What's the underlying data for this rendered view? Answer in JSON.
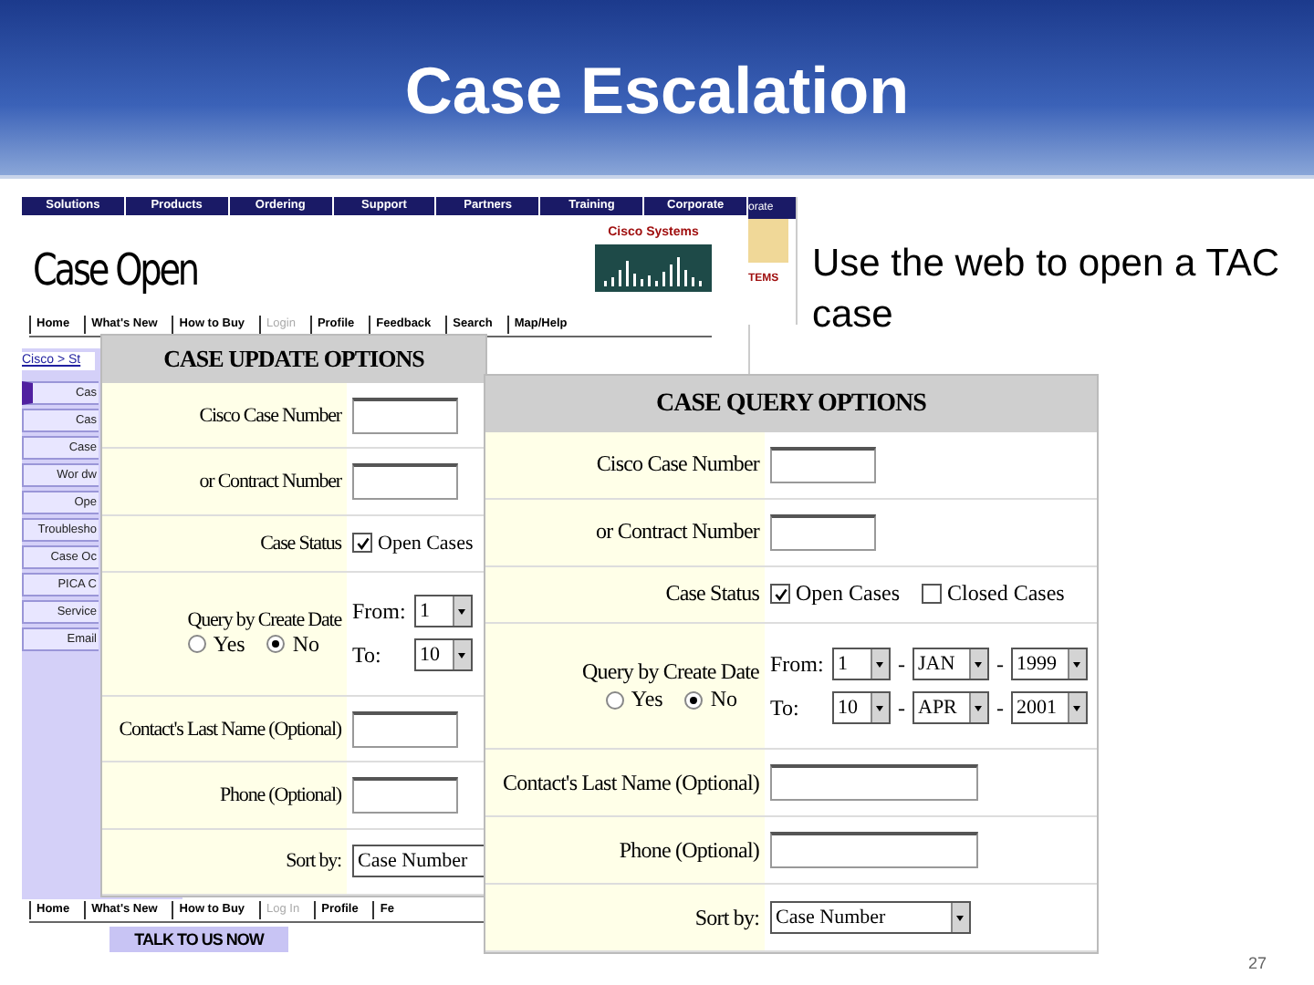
{
  "slide": {
    "title": "Case Escalation",
    "bullet": "Use the web to open a TAC case",
    "page_number": "27"
  },
  "case_open_page": {
    "top_nav": [
      "Solutions",
      "Products",
      "Ordering",
      "Support",
      "Partners",
      "Training",
      "Corporate"
    ],
    "heading": "Case Open",
    "logo_text": "Cisco Systems",
    "links": [
      {
        "label": "Home",
        "disabled": false
      },
      {
        "label": "What's New",
        "disabled": false
      },
      {
        "label": "How to Buy",
        "disabled": false
      },
      {
        "label": "Login",
        "disabled": true
      },
      {
        "label": "Profile",
        "disabled": false
      },
      {
        "label": "Feedback",
        "disabled": false
      },
      {
        "label": "Search",
        "disabled": false
      },
      {
        "label": "Map/Help",
        "disabled": false
      }
    ],
    "breadcrumb": "Cisco > St",
    "sidebar": [
      {
        "label": "Cas",
        "selected": true
      },
      {
        "label": "Cas",
        "selected": false
      },
      {
        "label": "Case",
        "selected": false
      },
      {
        "label": "Wor dw",
        "selected": false
      },
      {
        "label": "Ope",
        "selected": false
      },
      {
        "label": "Troublesho",
        "selected": false
      },
      {
        "label": "Case Oc",
        "selected": false
      },
      {
        "label": "PICA C",
        "selected": false
      },
      {
        "label": "Service",
        "selected": false
      },
      {
        "label": "Email",
        "selected": false
      }
    ],
    "footer_links": [
      {
        "label": "Home",
        "disabled": false
      },
      {
        "label": "What's New",
        "disabled": false
      },
      {
        "label": "How to Buy",
        "disabled": false
      },
      {
        "label": "Log In",
        "disabled": true
      },
      {
        "label": "Profile",
        "disabled": false
      },
      {
        "label": "Fe",
        "disabled": false
      }
    ],
    "banner": "TALK TO US NOW"
  },
  "second_page_fragment": {
    "nav_text": "orate",
    "logo_text": "TEMS"
  },
  "update_form": {
    "title": "CASE UPDATE OPTIONS",
    "rows": [
      {
        "kind": "text",
        "label": "Cisco Case Number"
      },
      {
        "kind": "text",
        "label": "or Contract Number"
      },
      {
        "kind": "checkboxes",
        "label": "Case Status",
        "options": [
          {
            "label": "Open Cases",
            "checked": true
          }
        ]
      },
      {
        "kind": "date",
        "label": "Query by Create Date",
        "radios": [
          {
            "label": "Yes",
            "selected": false
          },
          {
            "label": "No",
            "selected": true
          }
        ],
        "from_label": "From:",
        "to_label": "To:",
        "from": [
          "1"
        ],
        "to": [
          "10"
        ]
      },
      {
        "kind": "text",
        "label": "Contact's Last Name (Optional)"
      },
      {
        "kind": "text",
        "label": "Phone (Optional)"
      },
      {
        "kind": "select",
        "label": "Sort by:",
        "value": "Case Number"
      }
    ]
  },
  "query_form": {
    "title": "CASE QUERY OPTIONS",
    "rows": [
      {
        "kind": "text",
        "label": "Cisco Case Number"
      },
      {
        "kind": "text",
        "label": "or Contract Number"
      },
      {
        "kind": "checkboxes",
        "label": "Case Status",
        "options": [
          {
            "label": "Open Cases",
            "checked": true
          },
          {
            "label": "Closed Cases",
            "checked": false
          }
        ]
      },
      {
        "kind": "date",
        "label": "Query by Create Date",
        "radios": [
          {
            "label": "Yes",
            "selected": false
          },
          {
            "label": "No",
            "selected": true
          }
        ],
        "from_label": "From:",
        "to_label": "To:",
        "from": [
          "1",
          "JAN",
          "1999"
        ],
        "to": [
          "10",
          "APR",
          "2001"
        ],
        "from_separators": [
          "-",
          "-"
        ],
        "to_separators": [
          "-",
          "-"
        ]
      },
      {
        "kind": "text",
        "label": "Contact's Last Name (Optional)"
      },
      {
        "kind": "text",
        "label": "Phone (Optional)"
      },
      {
        "kind": "select",
        "label": "Sort by:",
        "value": "Case Number"
      }
    ]
  }
}
